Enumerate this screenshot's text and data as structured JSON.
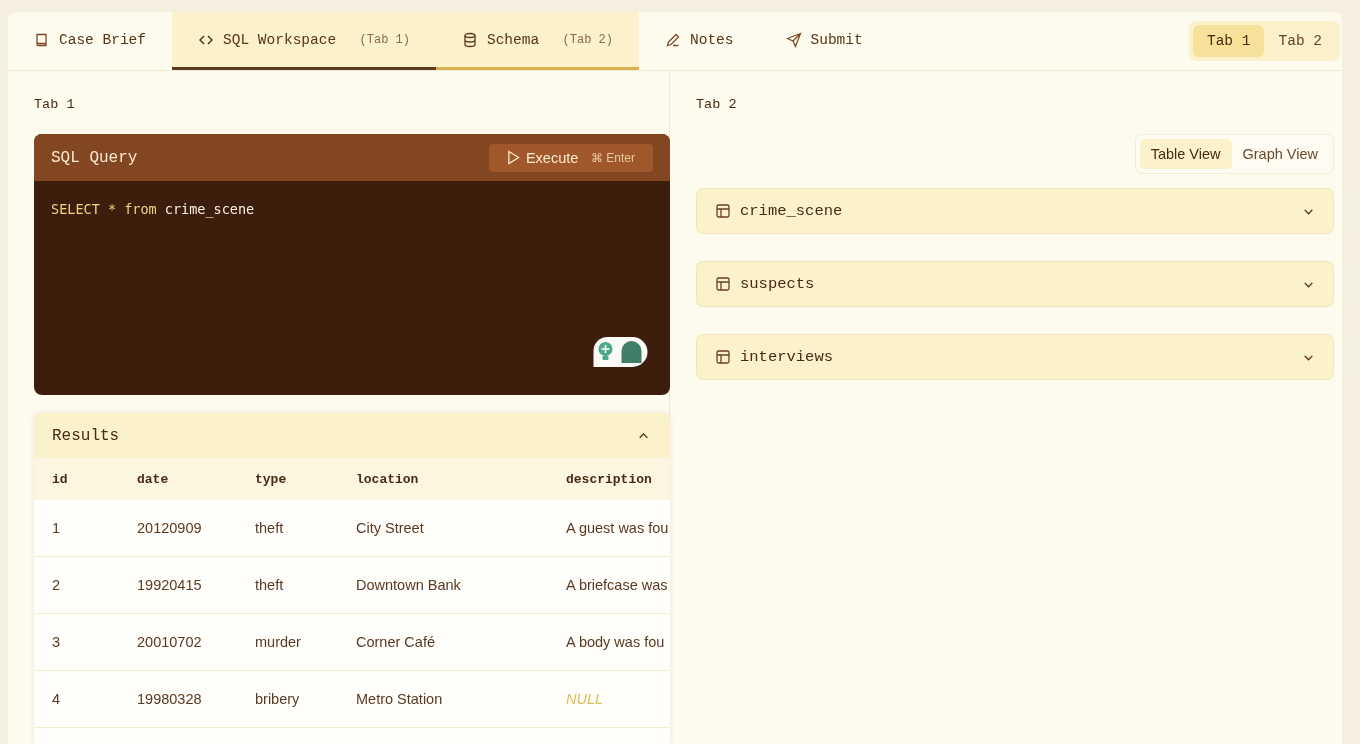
{
  "tabs": [
    {
      "label": "Case Brief",
      "kind": "plain",
      "selected": false
    },
    {
      "label": "SQL Workspace",
      "pane": "(Tab 1)",
      "kind": "primary",
      "selected": true
    },
    {
      "label": "Schema",
      "pane": "(Tab 2)",
      "kind": "secondary",
      "selected": true
    },
    {
      "label": "Notes",
      "kind": "plain",
      "selected": false
    },
    {
      "label": "Submit",
      "kind": "plain",
      "selected": false
    }
  ],
  "pane_toggle": [
    {
      "label": "Tab 1",
      "selected": true
    },
    {
      "label": "Tab 2",
      "selected": false
    }
  ],
  "left_pane": {
    "label": "Tab 1",
    "editor": {
      "title": "SQL Query",
      "execute_label": "Execute",
      "shortcut": "⌘ Enter",
      "query": [
        {
          "text": "SELECT",
          "kind": "keyword"
        },
        {
          "text": "*",
          "kind": "keyword"
        },
        {
          "text": "from",
          "kind": "keyword"
        },
        {
          "text": "crime_scene",
          "kind": "identifier"
        }
      ]
    },
    "results": {
      "title": "Results",
      "expanded": true,
      "columns": [
        "id",
        "date",
        "type",
        "location",
        "description"
      ],
      "rows": [
        {
          "cells": [
            {
              "text": "1",
              "kind": "value"
            },
            {
              "text": "20120909",
              "kind": "value"
            },
            {
              "text": "theft",
              "kind": "value"
            },
            {
              "text": "City Street",
              "kind": "value"
            },
            {
              "text": "A guest was fou",
              "kind": "value"
            }
          ]
        },
        {
          "cells": [
            {
              "text": "2",
              "kind": "value"
            },
            {
              "text": "19920415",
              "kind": "value"
            },
            {
              "text": "theft",
              "kind": "value"
            },
            {
              "text": "Downtown Bank",
              "kind": "value"
            },
            {
              "text": "A briefcase was",
              "kind": "value"
            }
          ]
        },
        {
          "cells": [
            {
              "text": "3",
              "kind": "value"
            },
            {
              "text": "20010702",
              "kind": "value"
            },
            {
              "text": "murder",
              "kind": "value"
            },
            {
              "text": "Corner Café",
              "kind": "value"
            },
            {
              "text": "A body was fou",
              "kind": "value"
            }
          ]
        },
        {
          "cells": [
            {
              "text": "4",
              "kind": "value"
            },
            {
              "text": "19980328",
              "kind": "value"
            },
            {
              "text": "bribery",
              "kind": "value"
            },
            {
              "text": "Metro Station",
              "kind": "value"
            },
            {
              "text": "NULL",
              "kind": "null"
            }
          ]
        }
      ]
    }
  },
  "right_pane": {
    "label": "Tab 2",
    "view_toggle": [
      {
        "label": "Table View",
        "selected": true
      },
      {
        "label": "Graph View",
        "selected": false
      }
    ],
    "tables": [
      {
        "name": "crime_scene",
        "expanded": false
      },
      {
        "name": "suspects",
        "expanded": false
      },
      {
        "name": "interviews",
        "expanded": false
      }
    ]
  }
}
